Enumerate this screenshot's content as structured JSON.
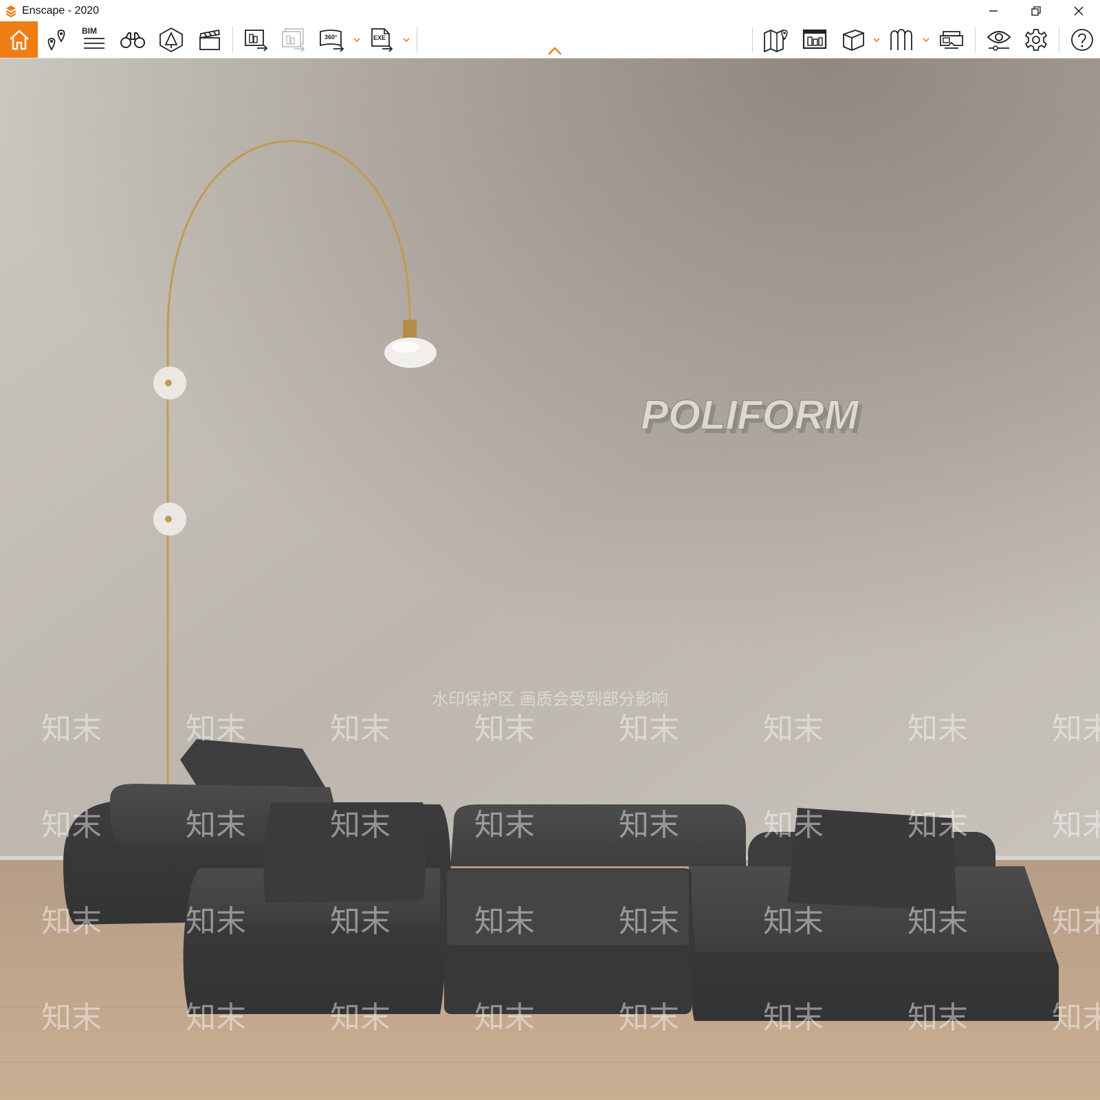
{
  "window": {
    "title": "Enscape - 2020",
    "controls": [
      "minimize",
      "restore",
      "close"
    ]
  },
  "toolbar": {
    "bim_label": "BIM",
    "panorama_label": "360°",
    "exe_label": "EXE",
    "left_icons": [
      "home-icon",
      "location-pins-icon",
      "bim-icon",
      "binoculars-icon",
      "atmosphere-icon",
      "clapper-icon",
      "render-screenshot-icon",
      "batch-render-icon",
      "panorama-360-icon",
      "export-exe-icon"
    ],
    "right_icons": [
      "map-icon",
      "asset-library-icon",
      "cube-icon",
      "material-icon",
      "vr-headset-icon",
      "visual-settings-icon",
      "settings-gear-icon",
      "help-icon"
    ],
    "accent_color": "#f07d14"
  },
  "viewport": {
    "wall_sign": "POLIFORM",
    "watermark_banner": "水印保护区   画质会受到部分影响",
    "watermark_tile": "知末"
  }
}
